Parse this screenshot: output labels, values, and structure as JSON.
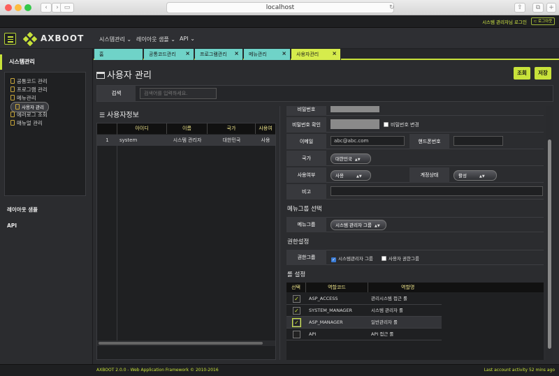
{
  "browser": {
    "url": "localhost"
  },
  "topbar": {
    "user_login": "시스템 관리자님 로그인",
    "logout": "⊂ 로그아웃"
  },
  "header": {
    "logo": "AXBOOT",
    "menus": [
      "시스템관리 ⌄",
      "레이아웃 샘플 ⌄",
      "API ⌄"
    ]
  },
  "sidebar": {
    "section1": "시스템관리",
    "tree": [
      "공통코드 관리",
      "프로그램 관리",
      "메뉴관리",
      "사용자 관리",
      "에러로그 조회",
      "매뉴얼 관리"
    ],
    "section2": "레이아웃 샘플",
    "section3": "API"
  },
  "tabs": [
    "홈",
    "공통코드관리",
    "프로그램관리",
    "메뉴관리",
    "사용자관리"
  ],
  "page": {
    "title": "사용자 관리",
    "btn_search": "조회",
    "btn_save": "저장"
  },
  "search": {
    "label": "검색",
    "placeholder": "검색어를 입력하세요."
  },
  "grid": {
    "title": "사용자정보",
    "headers": [
      "아이디",
      "이름",
      "국가",
      "사용여"
    ],
    "rows": [
      {
        "no": "1",
        "id": "system",
        "name": "시스템 관리자",
        "country": "대한민국",
        "use": "사용"
      }
    ]
  },
  "form": {
    "password": "비밀번호",
    "password_confirm": "비밀번호 확인",
    "change_pw": "비밀번호 변경",
    "email_label": "이메일",
    "email_value": "abc@abc.com",
    "phone_label": "핸드폰번호",
    "country_label": "국가",
    "country_value": "대한민국",
    "use_label": "사용여부",
    "use_value": "사용",
    "account_label": "계정상태",
    "account_value": "활성",
    "remark_label": "비고",
    "menugroup_title": "메뉴그룹 선택",
    "menugroup_label": "메뉴그룹",
    "menugroup_value": "시스템 관리자 그룹",
    "auth_title": "권한설정",
    "auth_label": "권한그룹",
    "auth_opt1": "시스템관리자 그룹",
    "auth_opt2": "사용자 권한그룹",
    "role_title": "롤 설정"
  },
  "roles": {
    "headers": [
      "선택",
      "역할코드",
      "역할명"
    ],
    "rows": [
      {
        "checked": true,
        "code": "ASP_ACCESS",
        "name": "관리시스템 접근 롤"
      },
      {
        "checked": true,
        "code": "SYSTEM_MANAGER",
        "name": "시스템 관리자 롤"
      },
      {
        "checked": true,
        "code": "ASP_MANAGER",
        "name": "일반관리자 롤"
      },
      {
        "checked": false,
        "code": "API",
        "name": "API 접근 롤"
      }
    ]
  },
  "footer": {
    "left": "AXBOOT 2.0.0 - Web Application Framework © 2010-2016",
    "right": "Last account activity 52 mins ago"
  },
  "colors": {
    "accent": "#c8e23a",
    "tab": "#6fd3c8"
  }
}
